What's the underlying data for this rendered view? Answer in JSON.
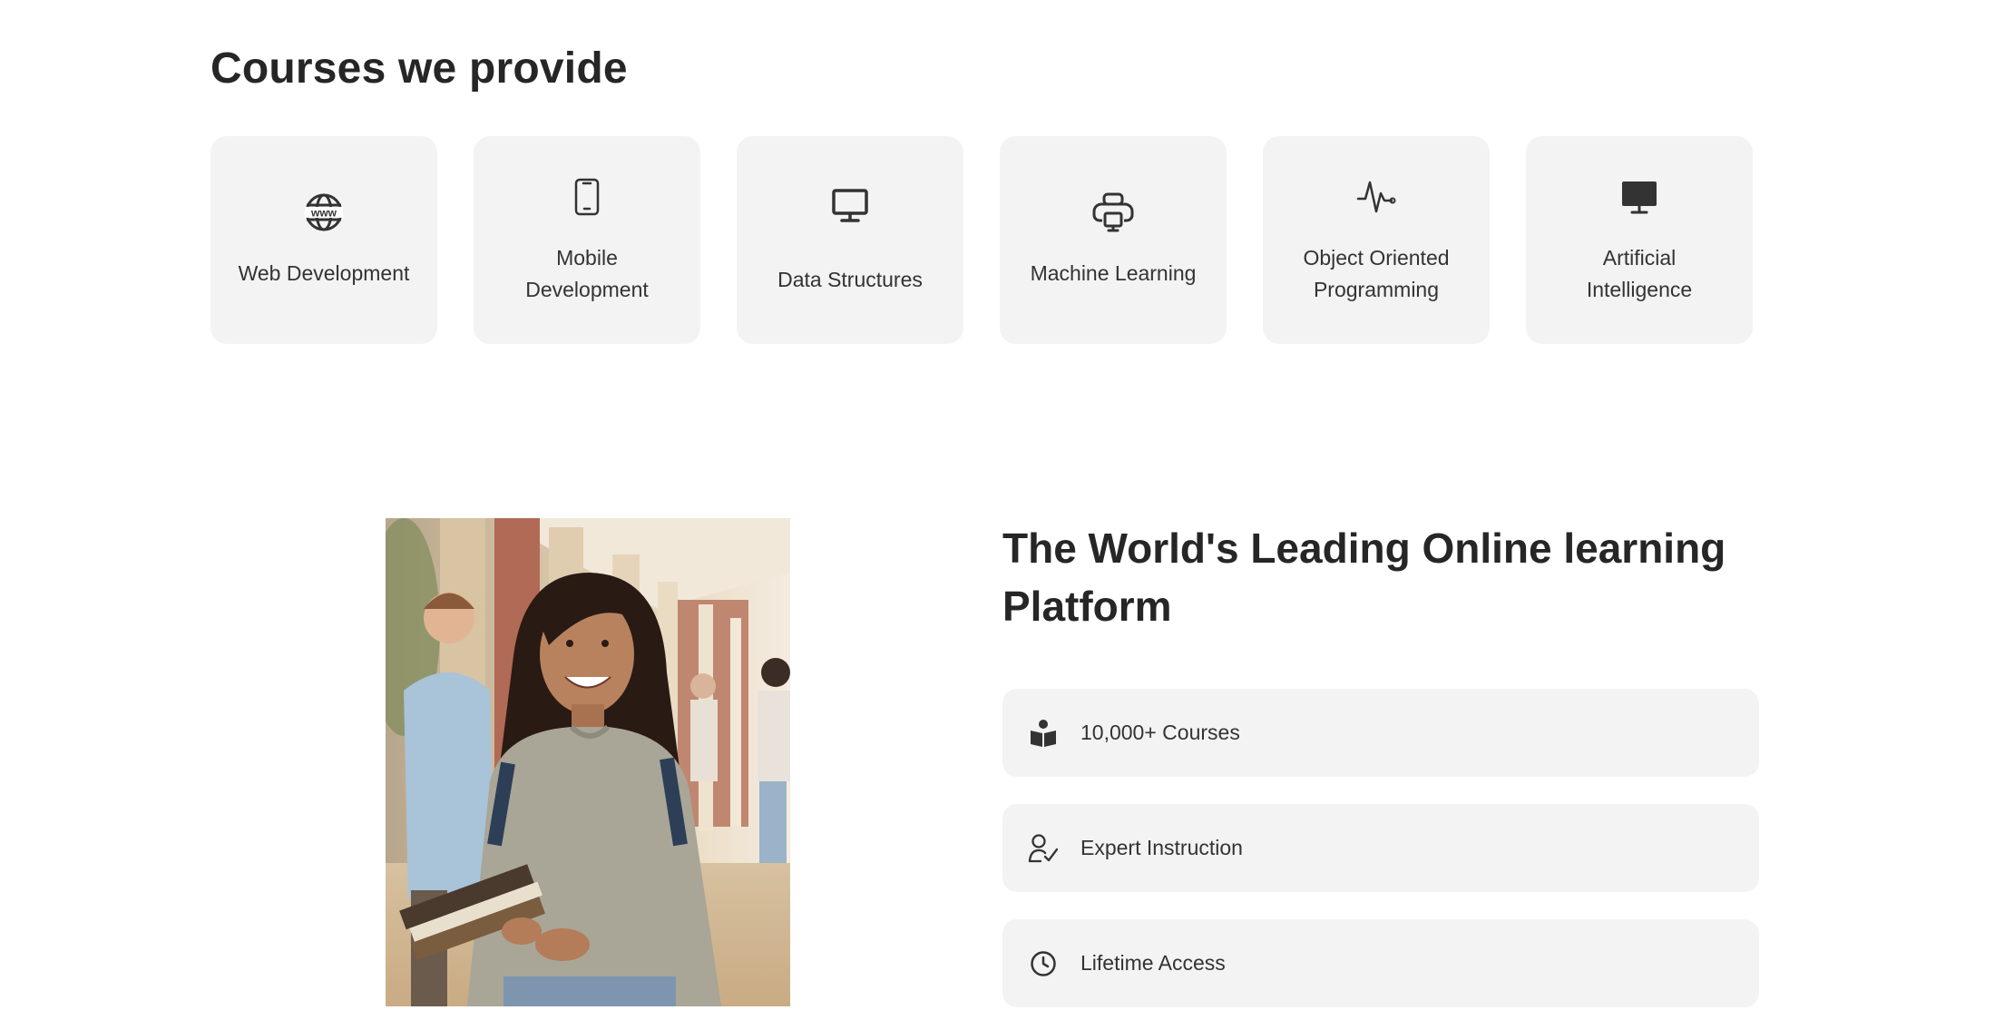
{
  "courses": {
    "title": "Courses we provide",
    "items": [
      {
        "label": "Web Development",
        "icon": "www-globe-icon"
      },
      {
        "label": "Mobile Development",
        "icon": "mobile-phone-icon"
      },
      {
        "label": "Data Structures",
        "icon": "monitor-icon"
      },
      {
        "label": "Machine Learning",
        "icon": "printer-icon"
      },
      {
        "label": "Object Oriented Programming",
        "icon": "pulse-icon"
      },
      {
        "label": "Artificial Intelligence",
        "icon": "desktop-filled-icon"
      }
    ]
  },
  "platform": {
    "title": "The World's Leading Online learning Platform",
    "image_alt": "smiling student holding books in a corridor",
    "features": [
      {
        "label": "10,000+ Courses",
        "icon": "book-reader-icon"
      },
      {
        "label": "Expert Instruction",
        "icon": "user-check-icon"
      },
      {
        "label": "Lifetime Access",
        "icon": "clock-icon"
      }
    ]
  },
  "colors": {
    "card_bg": "#f3f3f3",
    "text": "#262626",
    "background": "#ffffff"
  }
}
